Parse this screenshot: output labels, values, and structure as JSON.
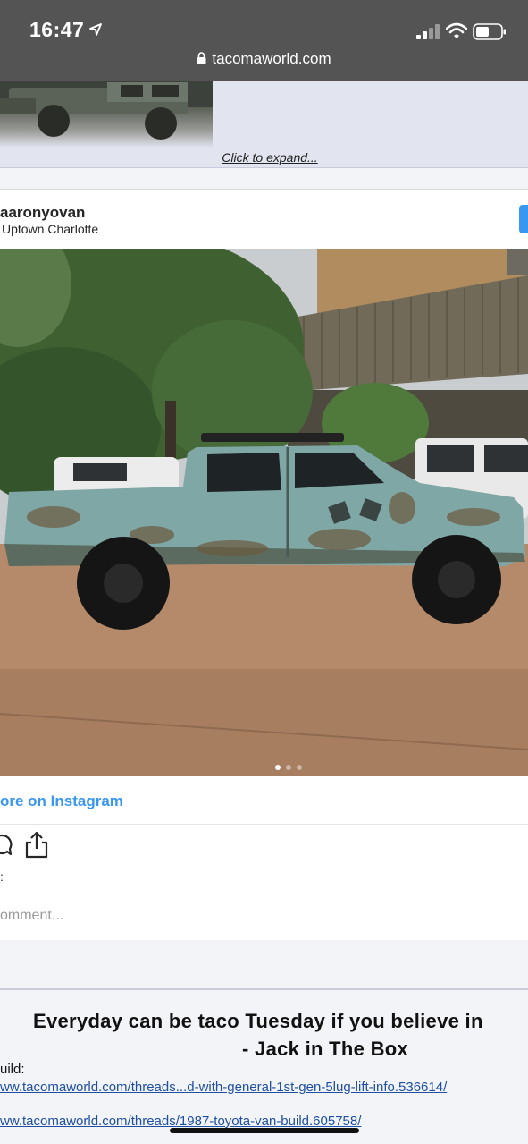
{
  "status_bar": {
    "time": "16:47",
    "url": "tacomaworld.com",
    "icons": [
      "location-arrow-icon",
      "signal-icon",
      "wifi-icon",
      "battery-icon",
      "lock-icon"
    ]
  },
  "attachment": {
    "expand_link": "Click to expand..."
  },
  "instagram": {
    "username": "aaronyovan",
    "location": "Uptown Charlotte",
    "view_more": "ore on Instagram",
    "likes_fragment": ":",
    "add_comment_placeholder": "omment...",
    "accent_color": "#3897f0",
    "carousel_total": 3,
    "carousel_active": 1
  },
  "signature": {
    "quote_line1": "Everyday can be taco Tuesday if you believe in",
    "quote_line2": "- Jack in The Box",
    "build_label": "uild:",
    "link1": "ww.tacomaworld.com/threads...d-with-general-1st-gen-5lug-lift-info.536614/",
    "link2": "ww.tacomaworld.com/threads/1987-toyota-van-build.605758/",
    "link_color": "#1f4fa3"
  }
}
